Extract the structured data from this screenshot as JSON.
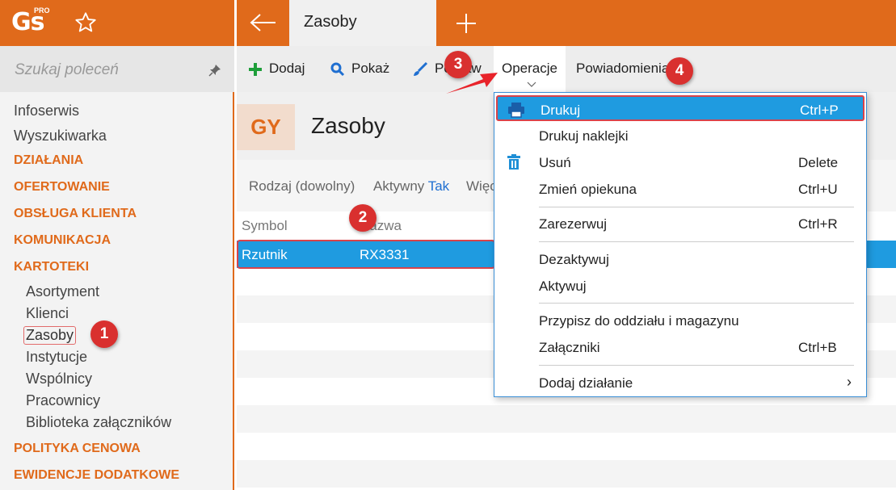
{
  "topbar": {
    "logo": "Gs",
    "logo_sup": "PRO",
    "tab_title": "Zasoby"
  },
  "sidebar": {
    "search_placeholder": "Szukaj poleceń",
    "items": [
      {
        "label": "Infoserwis",
        "kind": "item"
      },
      {
        "label": "Wyszukiwarka",
        "kind": "item"
      },
      {
        "label": "DZIAŁANIA",
        "kind": "section"
      },
      {
        "label": "OFERTOWANIE",
        "kind": "section"
      },
      {
        "label": "OBSŁUGA KLIENTA",
        "kind": "section"
      },
      {
        "label": "KOMUNIKACJA",
        "kind": "section"
      },
      {
        "label": "KARTOTEKI",
        "kind": "section"
      },
      {
        "label": "Asortyment",
        "kind": "sub"
      },
      {
        "label": "Klienci",
        "kind": "sub"
      },
      {
        "label": "Zasoby",
        "kind": "sub",
        "active": true
      },
      {
        "label": "Instytucje",
        "kind": "sub"
      },
      {
        "label": "Wspólnicy",
        "kind": "sub"
      },
      {
        "label": "Pracownicy",
        "kind": "sub"
      },
      {
        "label": "Biblioteka załączników",
        "kind": "sub"
      },
      {
        "label": "POLITYKA CENOWA",
        "kind": "section"
      },
      {
        "label": "EWIDENCJE DODATKOWE",
        "kind": "section"
      }
    ]
  },
  "toolbar": {
    "add": "Dodaj",
    "show": "Pokaż",
    "edit": "Popraw",
    "operations": "Operacje",
    "notifications": "Powiadomienia"
  },
  "header": {
    "badge": "GY",
    "title": "Zasoby"
  },
  "filters": {
    "type": "Rodzaj (dowolny)",
    "active_label": "Aktywny",
    "active_value": "Tak",
    "more": "Więc"
  },
  "grid": {
    "columns": [
      "Symbol",
      "Nazwa"
    ],
    "rows": [
      {
        "symbol": "Rzutnik",
        "name": "RX3331",
        "selected": true
      }
    ]
  },
  "dropdown": {
    "items": [
      {
        "label": "Drukuj",
        "shortcut": "Ctrl+P",
        "icon": "printer-icon",
        "highlighted": true
      },
      {
        "label": "Drukuj naklejki",
        "shortcut": ""
      },
      {
        "label": "Usuń",
        "shortcut": "Delete",
        "icon": "trash-icon"
      },
      {
        "label": "Zmień opiekuna",
        "shortcut": "Ctrl+U"
      },
      {
        "label": "Zarezerwuj",
        "shortcut": "Ctrl+R"
      },
      {
        "label": "Dezaktywuj",
        "shortcut": ""
      },
      {
        "label": "Aktywuj",
        "shortcut": ""
      },
      {
        "label": "Przypisz do oddziału i magazynu",
        "shortcut": ""
      },
      {
        "label": "Załączniki",
        "shortcut": "Ctrl+B"
      },
      {
        "label": "Dodaj działanie",
        "shortcut": "",
        "submenu": true
      }
    ],
    "submenu_glyph": "›"
  },
  "callouts": [
    "1",
    "2",
    "3",
    "4"
  ],
  "colors": {
    "accent": "#e06a1b",
    "selection": "#1f9be0",
    "callout": "#d9302f"
  }
}
